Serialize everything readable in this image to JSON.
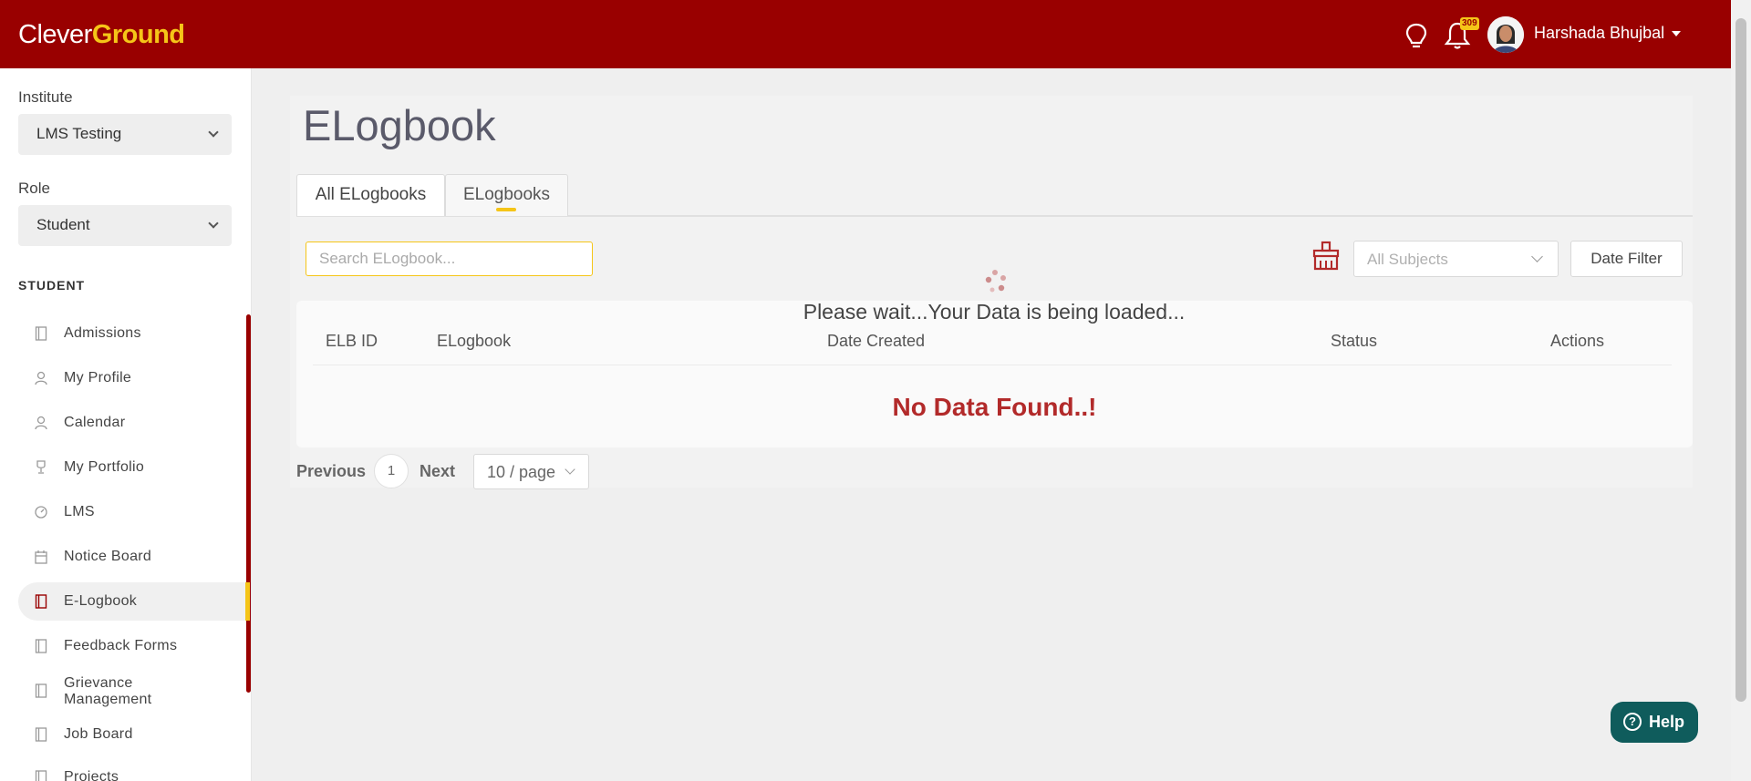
{
  "app": {
    "logo_part1": "Clever",
    "logo_part2": "Ground",
    "brand_color": "#990000",
    "accent_color": "#f5c518"
  },
  "header": {
    "notification_count": "309",
    "user_name": "Harshada Bhujbal",
    "icons": [
      "lightbulb-icon",
      "bell-icon",
      "user-avatar",
      "caret-down-icon"
    ]
  },
  "sidebar": {
    "institute_label": "Institute",
    "institute_value": "LMS Testing",
    "role_label": "Role",
    "role_value": "Student",
    "section_title": "STUDENT",
    "items": [
      {
        "label": "Admissions",
        "icon": "book-icon",
        "active": false
      },
      {
        "label": "My Profile",
        "icon": "user-icon",
        "active": false
      },
      {
        "label": "Calendar",
        "icon": "user-icon",
        "active": false
      },
      {
        "label": "My Portfolio",
        "icon": "trophy-icon",
        "active": false
      },
      {
        "label": "LMS",
        "icon": "gauge-icon",
        "active": false
      },
      {
        "label": "Notice Board",
        "icon": "calendar-icon",
        "active": false
      },
      {
        "label": "E-Logbook",
        "icon": "book-icon",
        "active": true
      },
      {
        "label": "Feedback Forms",
        "icon": "book-icon",
        "active": false
      },
      {
        "label": "Grievance Management",
        "icon": "book-icon",
        "active": false
      },
      {
        "label": "Job Board",
        "icon": "book-icon",
        "active": false
      },
      {
        "label": "Projects",
        "icon": "book-icon",
        "active": false
      }
    ]
  },
  "main": {
    "title": "ELogbook",
    "tabs": [
      {
        "label": "All ELogbooks",
        "active": true
      },
      {
        "label": "ELogbooks",
        "active": false
      }
    ],
    "search_placeholder": "Search ELogbook...",
    "subject_filter": "All Subjects",
    "date_filter_label": "Date Filter",
    "loading_text": "Please wait...Your Data is being loaded...",
    "columns": [
      "ELB ID",
      "ELogbook",
      "Date Created",
      "Status",
      "Actions"
    ],
    "empty_text": "No Data Found..!",
    "pagination": {
      "previous": "Previous",
      "current_page": "1",
      "next": "Next",
      "page_size": "10 / page"
    }
  },
  "help_button": "Help"
}
